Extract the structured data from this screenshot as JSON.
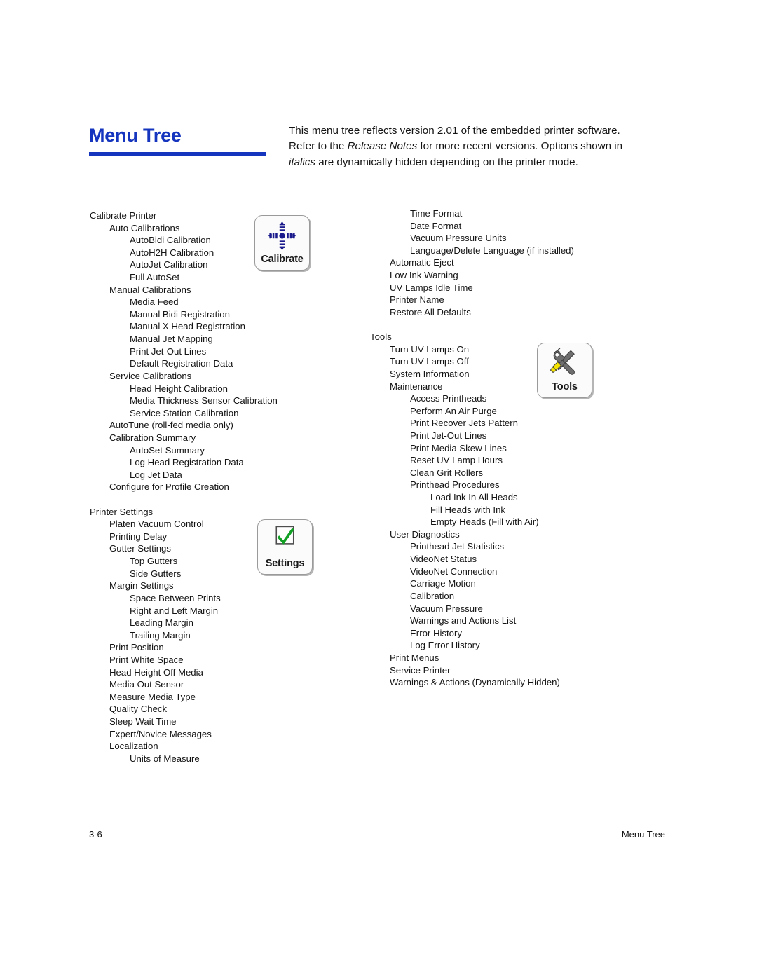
{
  "header": {
    "title": "Menu Tree",
    "intro_segments": [
      {
        "text": "This menu tree reflects version 2.01 of the embedded printer software. Refer to the ",
        "italic": false
      },
      {
        "text": "Release Notes",
        "italic": true
      },
      {
        "text": " for more recent versions. Options shown in ",
        "italic": false
      },
      {
        "text": "italics",
        "italic": true
      },
      {
        "text": " are dynamically hidden depending on the printer mode.",
        "italic": false
      }
    ],
    "rule_color": "#1535bf",
    "title_color": "#1535bf"
  },
  "icons": [
    {
      "name": "calibrate-icon-button",
      "caption": "Calibrate",
      "glyph": "calibrate-crosshair",
      "color": "#1a1a8c"
    },
    {
      "name": "settings-icon-button",
      "caption": "Settings",
      "glyph": "green-checkmark-box",
      "color": "#0f9a20"
    },
    {
      "name": "tools-icon-button",
      "caption": "Tools",
      "glyph": "wrench-screwdriver",
      "color": "#6e6e6e",
      "accent": "#f5e400"
    }
  ],
  "left_column": [
    {
      "label": "Calibrate Printer",
      "level": 0
    },
    {
      "label": "Auto Calibrations",
      "level": 1
    },
    {
      "label": "AutoBidi Calibration",
      "level": 2
    },
    {
      "label": "AutoH2H Calibration",
      "level": 2
    },
    {
      "label": "AutoJet Calibration",
      "level": 2
    },
    {
      "label": "Full AutoSet",
      "level": 2
    },
    {
      "label": "Manual Calibrations",
      "level": 1
    },
    {
      "label": "Media Feed",
      "level": 2
    },
    {
      "label": "Manual Bidi Registration",
      "level": 2
    },
    {
      "label": "Manual X Head Registration",
      "level": 2
    },
    {
      "label": "Manual Jet Mapping",
      "level": 2
    },
    {
      "label": "Print Jet-Out Lines",
      "level": 2
    },
    {
      "label": "Default Registration Data",
      "level": 2
    },
    {
      "label": "Service Calibrations",
      "level": 1
    },
    {
      "label": "Head Height Calibration",
      "level": 2
    },
    {
      "label": "Media Thickness Sensor Calibration",
      "level": 2
    },
    {
      "label": "Service Station Calibration",
      "level": 2
    },
    {
      "label": "AutoTune (roll-fed media only)",
      "level": 1
    },
    {
      "label": "Calibration Summary",
      "level": 1
    },
    {
      "label": "AutoSet Summary",
      "level": 2
    },
    {
      "label": "Log Head Registration Data",
      "level": 2
    },
    {
      "label": "Log Jet Data",
      "level": 2
    },
    {
      "label": "Configure for Profile Creation",
      "level": 1
    },
    {
      "label": "",
      "level": -1
    },
    {
      "label": "Printer Settings",
      "level": 0
    },
    {
      "label": "Platen Vacuum Control",
      "level": 1
    },
    {
      "label": "Printing Delay",
      "level": 1
    },
    {
      "label": "Gutter Settings",
      "level": 1
    },
    {
      "label": "Top Gutters",
      "level": 2
    },
    {
      "label": "Side Gutters",
      "level": 2
    },
    {
      "label": "Margin Settings",
      "level": 1
    },
    {
      "label": "Space Between Prints",
      "level": 2
    },
    {
      "label": "Right and Left Margin",
      "level": 2
    },
    {
      "label": "Leading Margin",
      "level": 2
    },
    {
      "label": "Trailing Margin",
      "level": 2
    },
    {
      "label": "Print Position",
      "level": 1
    },
    {
      "label": "Print White Space",
      "level": 1
    },
    {
      "label": "Head Height Off Media",
      "level": 1
    },
    {
      "label": "Media Out Sensor",
      "level": 1
    },
    {
      "label": "Measure Media Type",
      "level": 1
    },
    {
      "label": "Quality Check",
      "level": 1
    },
    {
      "label": "Sleep Wait Time",
      "level": 1
    },
    {
      "label": "Expert/Novice Messages",
      "level": 1
    },
    {
      "label": "Localization",
      "level": 1
    },
    {
      "label": "Units of Measure",
      "level": 2
    }
  ],
  "right_column": [
    {
      "label": "Time Format",
      "level": 2
    },
    {
      "label": "Date Format",
      "level": 2
    },
    {
      "label": "Vacuum Pressure Units",
      "level": 2
    },
    {
      "label": "Language/Delete Language (if installed)",
      "level": 2
    },
    {
      "label": "Automatic Eject",
      "level": 1
    },
    {
      "label": "Low Ink Warning",
      "level": 1
    },
    {
      "label": "UV Lamps Idle Time",
      "level": 1
    },
    {
      "label": "Printer Name",
      "level": 1
    },
    {
      "label": "Restore All Defaults",
      "level": 1
    },
    {
      "label": "",
      "level": -1
    },
    {
      "label": "Tools",
      "level": 0
    },
    {
      "label": "Turn UV Lamps On",
      "level": 1
    },
    {
      "label": "Turn UV Lamps Off",
      "level": 1
    },
    {
      "label": "System Information",
      "level": 1
    },
    {
      "label": "Maintenance",
      "level": 1
    },
    {
      "label": "Access Printheads",
      "level": 2
    },
    {
      "label": "Perform An Air Purge",
      "level": 2
    },
    {
      "label": "Print Recover Jets Pattern",
      "level": 2
    },
    {
      "label": "Print Jet-Out Lines",
      "level": 2
    },
    {
      "label": "Print Media Skew Lines",
      "level": 2
    },
    {
      "label": "Reset UV Lamp Hours",
      "level": 2
    },
    {
      "label": "Clean Grit Rollers",
      "level": 2
    },
    {
      "label": "Printhead Procedures",
      "level": 2
    },
    {
      "label": "Load Ink In All Heads",
      "level": 3
    },
    {
      "label": "Fill Heads with Ink",
      "level": 3
    },
    {
      "label": "Empty Heads (Fill with Air)",
      "level": 3
    },
    {
      "label": "User Diagnostics",
      "level": 1
    },
    {
      "label": "Printhead Jet Statistics",
      "level": 2
    },
    {
      "label": "VideoNet Status",
      "level": 2
    },
    {
      "label": "VideoNet Connection",
      "level": 2
    },
    {
      "label": "Carriage Motion",
      "level": 2
    },
    {
      "label": "Calibration",
      "level": 2
    },
    {
      "label": "Vacuum Pressure",
      "level": 2
    },
    {
      "label": "Warnings and Actions List",
      "level": 2
    },
    {
      "label": "Error History",
      "level": 2
    },
    {
      "label": "Log Error History",
      "level": 2
    },
    {
      "label": "Print Menus",
      "level": 1
    },
    {
      "label": "Service Printer",
      "level": 1
    },
    {
      "label": "Warnings & Actions (Dynamically Hidden)",
      "level": 1
    }
  ],
  "footer": {
    "page_number": "3-6",
    "section": "Menu Tree"
  }
}
